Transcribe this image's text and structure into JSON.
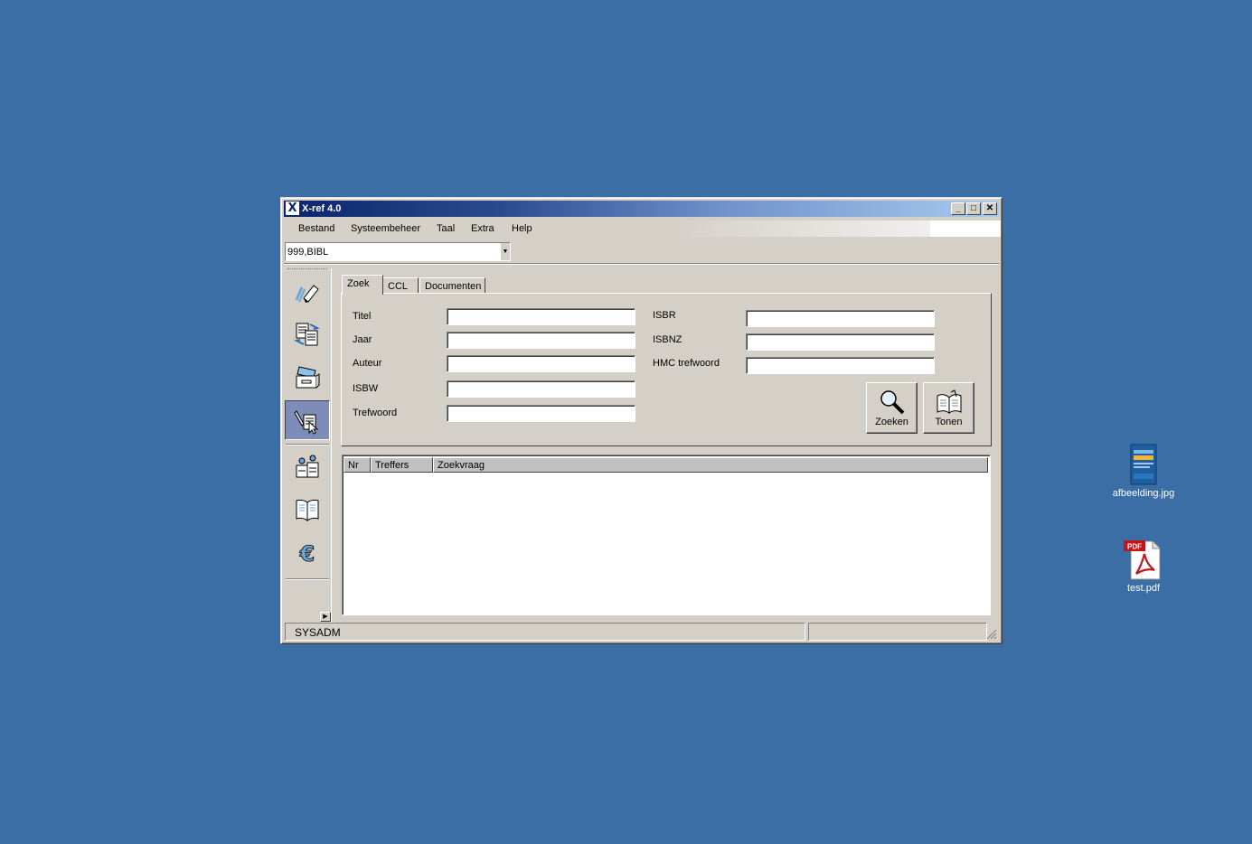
{
  "window": {
    "title": "X-ref 4.0",
    "app_icon_letter": "X",
    "controls": {
      "minimize": "_",
      "maximize": "□",
      "close": "✕"
    }
  },
  "menu": {
    "items": [
      "Bestand",
      "Systeembeheer",
      "Taal",
      "Extra",
      "Help"
    ]
  },
  "database_select": {
    "value": "999,BIBL"
  },
  "toolbar": {
    "buttons": [
      {
        "icon": "pencil-eraser-icon"
      },
      {
        "icon": "documents-exchange-icon"
      },
      {
        "icon": "card-drawer-icon"
      },
      {
        "icon": "search-pen-document-icon",
        "active": true
      },
      {
        "icon": "people-building-icon"
      },
      {
        "icon": "open-book-icon"
      },
      {
        "icon": "euro-icon"
      }
    ]
  },
  "tabs": {
    "items": [
      "Zoek",
      "CCL",
      "Documenten"
    ],
    "active": "Zoek"
  },
  "search_form": {
    "left_fields": [
      "Titel",
      "Jaar",
      "Auteur",
      "ISBW",
      "Trefwoord"
    ],
    "right_fields": [
      "ISBR",
      "ISBNZ",
      "HMC trefwoord"
    ],
    "search_button": "Zoeken",
    "show_button": "Tonen"
  },
  "results_table": {
    "columns": [
      "Nr",
      "Treffers",
      "Zoekvraag"
    ],
    "rows": []
  },
  "statusbar": {
    "user": "SYSADM",
    "info": ""
  },
  "desktop": {
    "icons": [
      {
        "label": "afbeelding.jpg",
        "icon": "image-file-icon"
      },
      {
        "label": "test.pdf",
        "icon": "pdf-file-icon"
      }
    ]
  },
  "colors": {
    "desktop": "#3a6ea5",
    "title_start": "#0a246a",
    "title_end": "#a6caf0",
    "active_tool": "#7e8db8"
  }
}
